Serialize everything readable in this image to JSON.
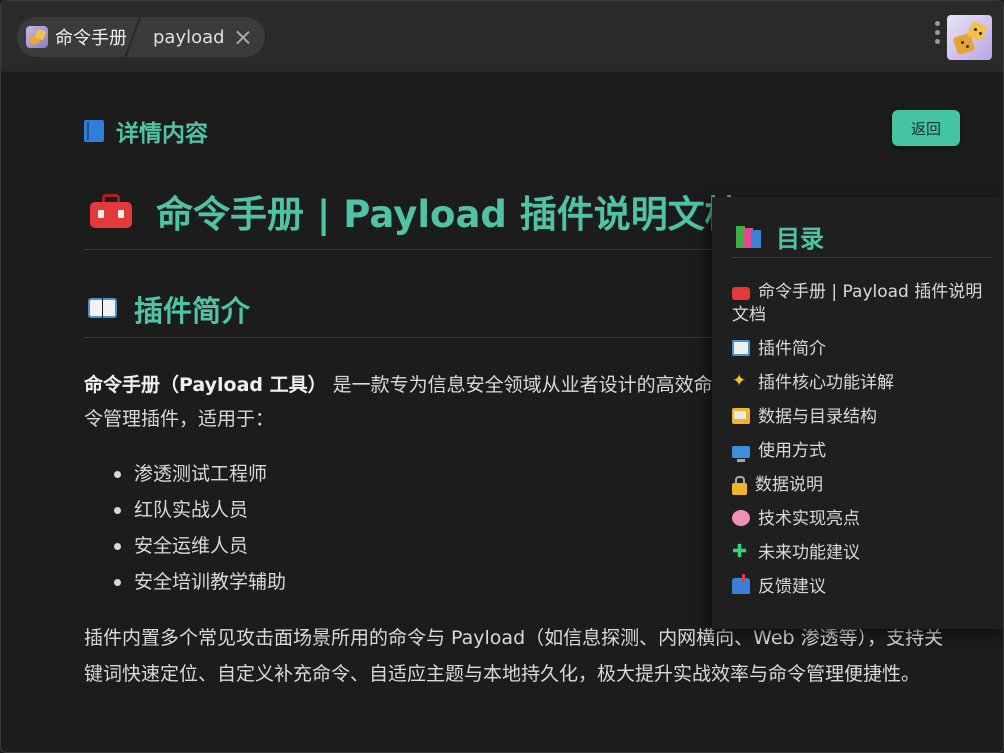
{
  "topbar": {
    "app_label": "命令手册",
    "tab_label": "payload"
  },
  "main": {
    "section_heading": "详情内容",
    "back_button": "返回",
    "doc_title": "命令手册 | Payload 插件说明文档",
    "intro_heading": "插件简介",
    "intro_bold": "命令手册（Payload 工具）",
    "intro_text": " 是一款专为信息安全领域从业者设计的高效命令管理插件，适用于：",
    "audience": [
      "渗透测试工程师",
      "红队实战人员",
      "安全运维人员",
      "安全培训教学辅助"
    ],
    "summary": "插件内置多个常见攻击面场景所用的命令与 Payload（如信息探测、内网横向、Web 渗透等），支持关键词快速定位、自定义补充命令、自适应主题与本地持久化，极大提升实战效率与命令管理便捷性。"
  },
  "toc": {
    "heading": "目录",
    "items": [
      {
        "label": "命令手册 | Payload 插件说明文档",
        "icon": "toolbox-icon"
      },
      {
        "label": "插件简介",
        "icon": "open-book-icon"
      },
      {
        "label": "插件核心功能详解",
        "icon": "sparkles-icon"
      },
      {
        "label": "数据与目录结构",
        "icon": "folder-icon"
      },
      {
        "label": "使用方式",
        "icon": "monitor-icon"
      },
      {
        "label": "数据说明",
        "icon": "lock-icon"
      },
      {
        "label": "技术实现亮点",
        "icon": "brain-icon"
      },
      {
        "label": "未来功能建议",
        "icon": "puzzle-icon"
      },
      {
        "label": "反馈建议",
        "icon": "mailbox-icon"
      }
    ]
  },
  "colors": {
    "accent": "#4fc3a5",
    "button_bg": "#45c4a4",
    "background": "#1c1c1c",
    "topbar": "#2a2a2a"
  }
}
